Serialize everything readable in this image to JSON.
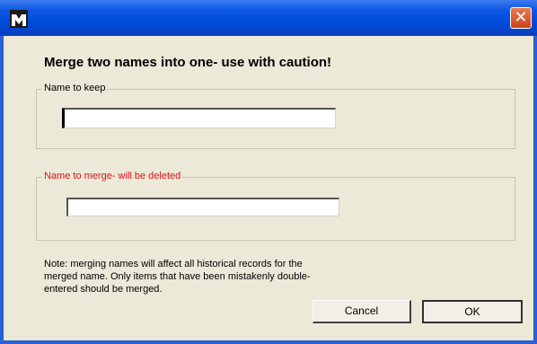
{
  "window": {
    "icon": "app-icon",
    "close_glyph": "✕",
    "titlebar_color": "#0a57e2"
  },
  "dialog": {
    "heading": "Merge two names into one- use with caution!",
    "keep_group": {
      "label": "Name to keep",
      "value": ""
    },
    "merge_group": {
      "label": "Name to merge- will be deleted",
      "label_color": "#e01010",
      "value": ""
    },
    "note": "Note: merging names will affect all historical records for the merged name. Only items that have been mistakenly double-entered should be merged.",
    "buttons": {
      "cancel": "Cancel",
      "ok": "OK"
    }
  }
}
